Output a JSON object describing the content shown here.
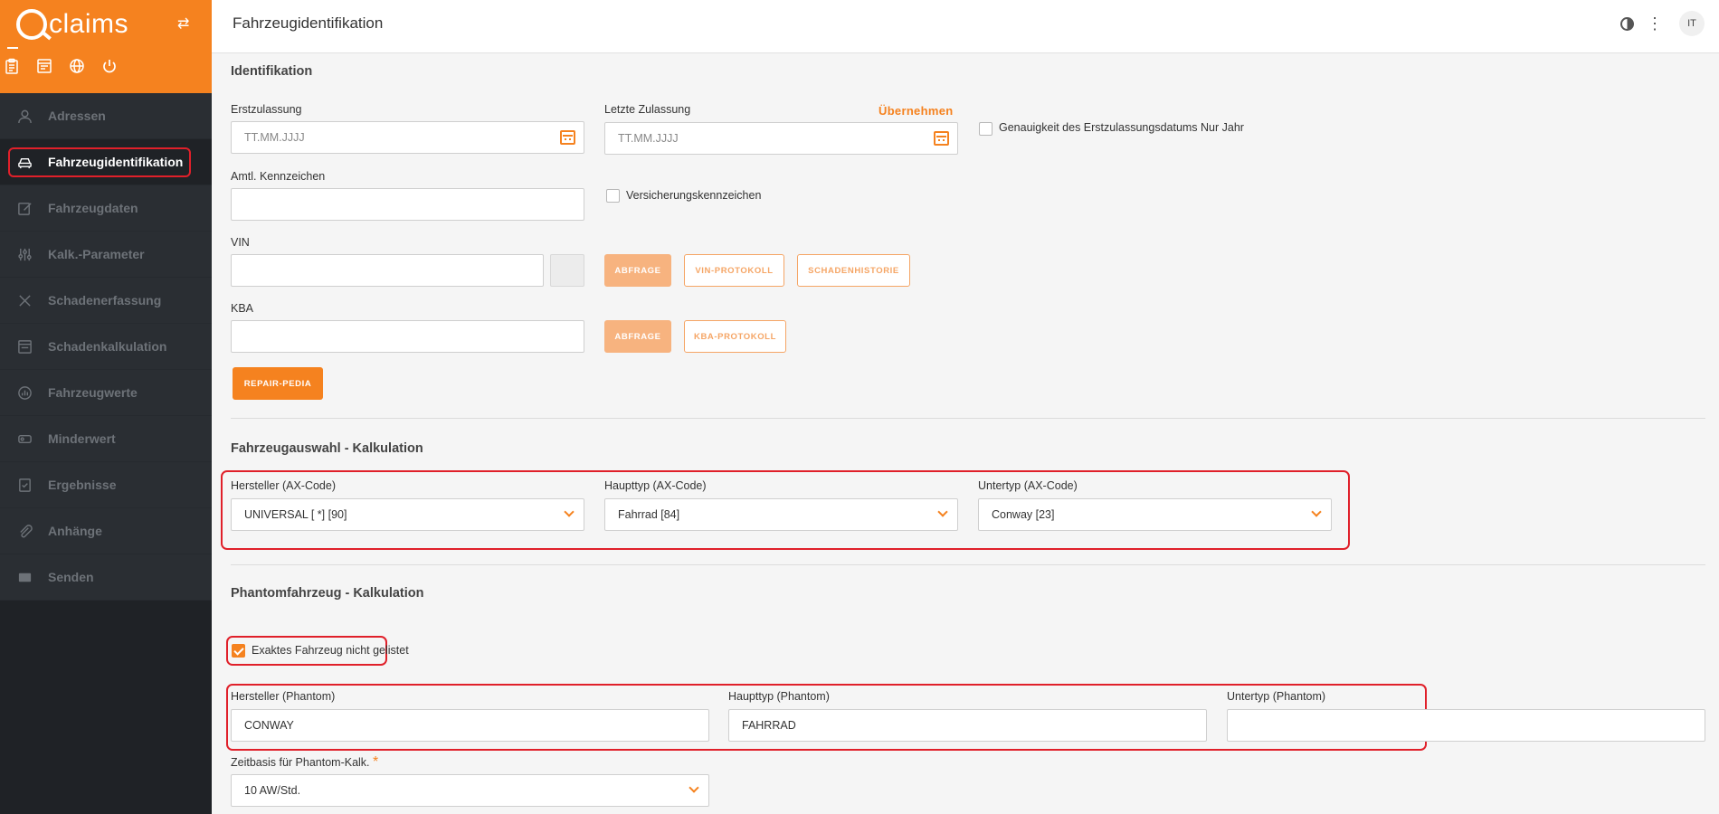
{
  "sidebar": {
    "logo_text": "claims",
    "nav": [
      {
        "label": "Adressen",
        "icon": "person-icon"
      },
      {
        "label": "Fahrzeugidentifikation",
        "icon": "car-icon"
      },
      {
        "label": "Fahrzeugdaten",
        "icon": "edit-icon"
      },
      {
        "label": "Kalk.-Parameter",
        "icon": "sliders-icon"
      },
      {
        "label": "Schadenerfassung",
        "icon": "tools-icon"
      },
      {
        "label": "Schadenkalkulation",
        "icon": "calculation-icon"
      },
      {
        "label": "Fahrzeugwerte",
        "icon": "chart-icon"
      },
      {
        "label": "Minderwert",
        "icon": "tag-icon"
      },
      {
        "label": "Ergebnisse",
        "icon": "result-icon"
      },
      {
        "label": "Anhänge",
        "icon": "paperclip-icon"
      },
      {
        "label": "Senden",
        "icon": "send-icon"
      }
    ],
    "active_index": 1
  },
  "header": {
    "title": "Fahrzeugidentifikation",
    "avatar": "IT"
  },
  "identifikation": {
    "title": "Identifikation",
    "erstzulassung_label": "Erstzulassung",
    "erstzulassung_placeholder": "TT.MM.JJJJ",
    "letzte_zulassung_label": "Letzte Zulassung",
    "letzte_zulassung_placeholder": "TT.MM.JJJJ",
    "uebernehmen": "Übernehmen",
    "genauigkeit_label": "Genauigkeit des Erstzulassungsdatums Nur Jahr",
    "kennzeichen_label": "Amtl. Kennzeichen",
    "versicherungskennzeichen_label": "Versicherungskennzeichen",
    "vin_label": "VIN",
    "abfrage": "ABFRAGE",
    "vin_protokoll": "VIN-PROTOKOLL",
    "schadenhistorie": "SCHADENHISTORIE",
    "kba_label": "KBA",
    "kba_protokoll": "KBA-PROTOKOLL",
    "repair_pedia": "REPAIR-PEDIA"
  },
  "fahrzeugauswahl": {
    "title": "Fahrzeugauswahl - Kalkulation",
    "hersteller_label": "Hersteller (AX-Code)",
    "hersteller_value": "UNIVERSAL [ *] [90]",
    "haupttyp_label": "Haupttyp (AX-Code)",
    "haupttyp_value": "Fahrrad [84]",
    "untertyp_label": "Untertyp (AX-Code)",
    "untertyp_value": "Conway [23]"
  },
  "phantom": {
    "title": "Phantomfahrzeug - Kalkulation",
    "exakt_label": "Exaktes Fahrzeug nicht gelistet",
    "exakt_checked": true,
    "hersteller_label": "Hersteller (Phantom)",
    "hersteller_value": "CONWAY",
    "haupttyp_label": "Haupttyp (Phantom)",
    "haupttyp_value": "FAHRRAD",
    "untertyp_label": "Untertyp (Phantom)",
    "untertyp_value": "",
    "zeitbasis_label": "Zeitbasis für Phantom-Kalk.",
    "zeitbasis_required": "*",
    "zeitbasis_value": "10 AW/Std."
  },
  "colors": {
    "accent": "#f5821f",
    "sidebar_bg": "#2a2e33",
    "highlight": "#e0202a"
  }
}
